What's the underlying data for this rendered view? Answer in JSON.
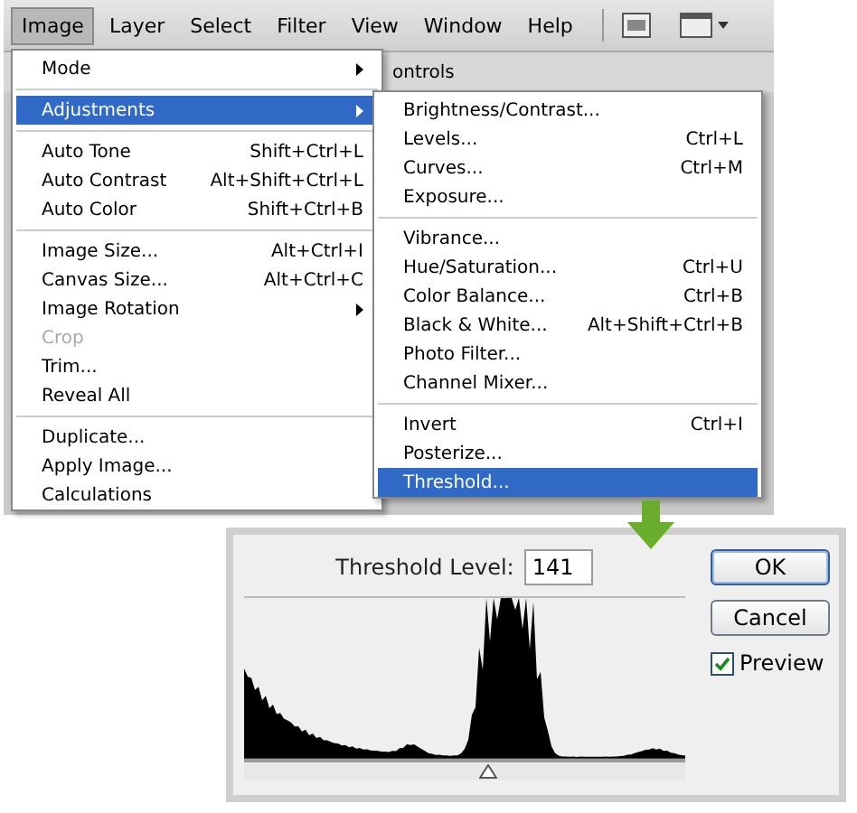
{
  "menubar": [
    {
      "label": "Image",
      "selected": true
    },
    {
      "label": "Layer",
      "selected": false
    },
    {
      "label": "Select",
      "selected": false
    },
    {
      "label": "Filter",
      "selected": false
    },
    {
      "label": "View",
      "selected": false
    },
    {
      "label": "Window",
      "selected": false
    },
    {
      "label": "Help",
      "selected": false
    }
  ],
  "toolbar": {
    "text": "ontrols"
  },
  "image_menu": [
    {
      "kind": "item",
      "label": "Mode",
      "submenu": true,
      "selected": false,
      "disabled": false
    },
    {
      "kind": "separator"
    },
    {
      "kind": "item",
      "label": "Adjustments",
      "submenu": true,
      "selected": true,
      "disabled": false
    },
    {
      "kind": "separator"
    },
    {
      "kind": "item",
      "label": "Auto Tone",
      "shortcut": "Shift+Ctrl+L",
      "selected": false,
      "disabled": false
    },
    {
      "kind": "item",
      "label": "Auto Contrast",
      "shortcut": "Alt+Shift+Ctrl+L",
      "selected": false,
      "disabled": false
    },
    {
      "kind": "item",
      "label": "Auto Color",
      "shortcut": "Shift+Ctrl+B",
      "selected": false,
      "disabled": false
    },
    {
      "kind": "separator"
    },
    {
      "kind": "item",
      "label": "Image Size...",
      "shortcut": "Alt+Ctrl+I",
      "selected": false,
      "disabled": false
    },
    {
      "kind": "item",
      "label": "Canvas Size...",
      "shortcut": "Alt+Ctrl+C",
      "selected": false,
      "disabled": false
    },
    {
      "kind": "item",
      "label": "Image Rotation",
      "submenu": true,
      "selected": false,
      "disabled": false
    },
    {
      "kind": "item",
      "label": "Crop",
      "selected": false,
      "disabled": true
    },
    {
      "kind": "item",
      "label": "Trim...",
      "selected": false,
      "disabled": false
    },
    {
      "kind": "item",
      "label": "Reveal All",
      "selected": false,
      "disabled": false
    },
    {
      "kind": "separator"
    },
    {
      "kind": "item",
      "label": "Duplicate...",
      "selected": false,
      "disabled": false
    },
    {
      "kind": "item",
      "label": "Apply Image...",
      "selected": false,
      "disabled": false
    },
    {
      "kind": "item",
      "label": "Calculations",
      "selected": false,
      "disabled": false
    }
  ],
  "adjustments_menu": [
    {
      "kind": "item",
      "label": "Brightness/Contrast...",
      "selected": false
    },
    {
      "kind": "item",
      "label": "Levels...",
      "shortcut": "Ctrl+L",
      "selected": false
    },
    {
      "kind": "item",
      "label": "Curves...",
      "shortcut": "Ctrl+M",
      "selected": false
    },
    {
      "kind": "item",
      "label": "Exposure...",
      "selected": false
    },
    {
      "kind": "separator"
    },
    {
      "kind": "item",
      "label": "Vibrance...",
      "selected": false
    },
    {
      "kind": "item",
      "label": "Hue/Saturation...",
      "shortcut": "Ctrl+U",
      "selected": false
    },
    {
      "kind": "item",
      "label": "Color Balance...",
      "shortcut": "Ctrl+B",
      "selected": false
    },
    {
      "kind": "item",
      "label": "Black & White...",
      "shortcut": "Alt+Shift+Ctrl+B",
      "selected": false
    },
    {
      "kind": "item",
      "label": "Photo Filter...",
      "selected": false
    },
    {
      "kind": "item",
      "label": "Channel Mixer...",
      "selected": false
    },
    {
      "kind": "separator"
    },
    {
      "kind": "item",
      "label": "Invert",
      "shortcut": "Ctrl+I",
      "selected": false
    },
    {
      "kind": "item",
      "label": "Posterize...",
      "selected": false
    },
    {
      "kind": "item",
      "label": "Threshold...",
      "selected": true
    }
  ],
  "threshold_dialog": {
    "label": "Threshold Level:",
    "value": "141",
    "slider": {
      "level": 0.553
    },
    "buttons": [
      {
        "label": "OK",
        "default": true
      },
      {
        "label": "Cancel",
        "default": false
      }
    ],
    "preview": {
      "label": "Preview",
      "checked": true
    }
  }
}
